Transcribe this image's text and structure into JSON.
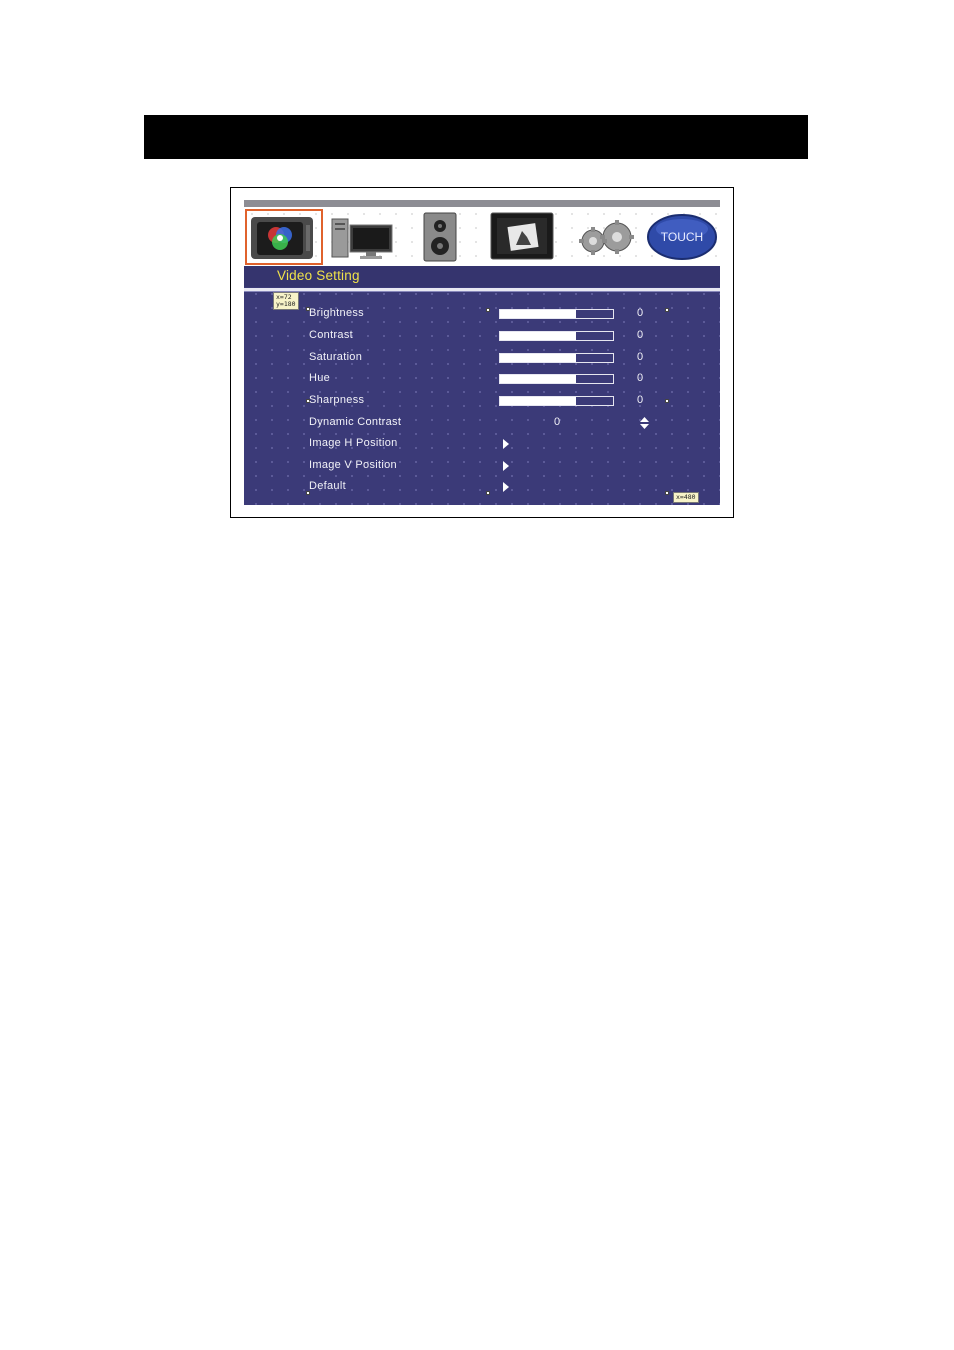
{
  "header": {
    "title": ""
  },
  "icon_bar": {
    "items": [
      {
        "icon": "tv-color-icon",
        "selected": true
      },
      {
        "icon": "pc-monitor-icon",
        "selected": false
      },
      {
        "icon": "speaker-icon",
        "selected": false
      },
      {
        "icon": "screen-image-icon",
        "selected": false
      },
      {
        "icon": "gears-icon",
        "selected": false
      },
      {
        "icon": "touch-icon",
        "label": "TOUCH",
        "selected": false
      }
    ]
  },
  "menu": {
    "title": "Video Setting",
    "sliders": [
      {
        "label": "Brightness",
        "value": "0",
        "level": 0.67
      },
      {
        "label": "Contrast",
        "value": "0",
        "level": 0.67
      },
      {
        "label": "Saturation",
        "value": "0",
        "level": 0.67
      },
      {
        "label": "Hue",
        "value": "0",
        "level": 0.67
      },
      {
        "label": "Sharpness",
        "value": "0",
        "level": 0.67
      }
    ],
    "dynamic_contrast": {
      "label": "Dynamic Contrast",
      "value": "0"
    },
    "submenus": [
      {
        "label": "Image H Position"
      },
      {
        "label": "Image V Position"
      },
      {
        "label": "Default"
      }
    ]
  },
  "annotations": {
    "top_left": "x=72\ny=180",
    "bottom_right": "x=480"
  },
  "colors": {
    "background": "#3b3a78",
    "title": "#f0e24a",
    "selection": "#e0622c",
    "text": "#f2f2f8"
  }
}
